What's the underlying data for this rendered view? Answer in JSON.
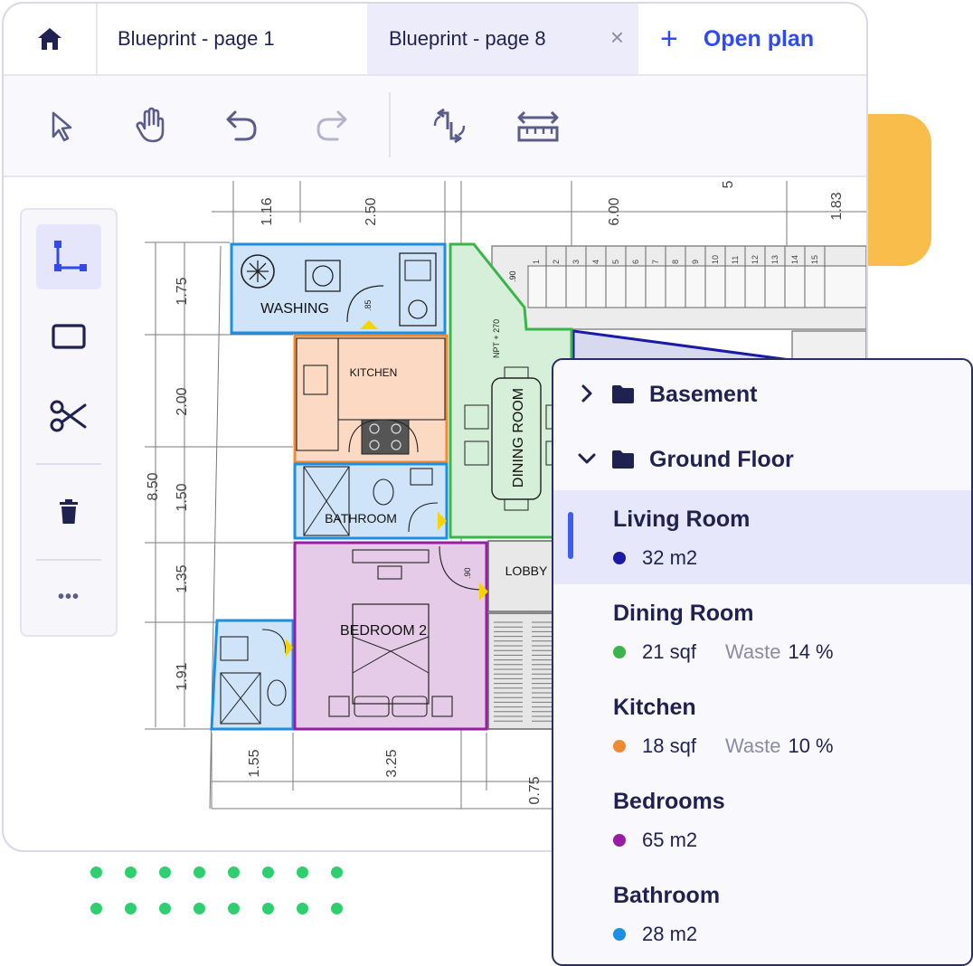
{
  "tabs": {
    "home_icon": "home-icon",
    "tab1": "Blueprint - page 1",
    "tab2": "Blueprint - page 8",
    "close_glyph": "×",
    "open_plan": "Open plan",
    "plus": "+"
  },
  "toolbar": {
    "tools": [
      "select-icon",
      "hand-icon",
      "undo-icon",
      "redo-icon",
      "rotate-icon",
      "measure-icon"
    ]
  },
  "sidebar": {
    "tools": [
      "line-tool-icon",
      "rectangle-icon",
      "scissors-icon",
      "trash-icon",
      "more-icon"
    ],
    "more_glyph": "•••"
  },
  "plan": {
    "rooms": {
      "washing": "WASHING",
      "kitchen": "KITCHEN",
      "bathroom": "BATHROOM",
      "bedroom": "BEDROOM 2",
      "dining": "DINING ROOM",
      "lobby": "LOBBY"
    },
    "dims_top": [
      "1.16",
      "2.50",
      "6.00",
      "5",
      "1.83"
    ],
    "dims_left": [
      "1.75",
      "2.00",
      "1.50",
      "1.35",
      "1.91"
    ],
    "dim_total": "8.50",
    "dims_bottom": [
      "1.55",
      "3.25",
      "0.75"
    ],
    "door_labels": [
      ".90",
      ".85",
      ".90"
    ],
    "npt": "NPT + 270",
    "stair_numbers": [
      "15",
      "14",
      "13",
      "12",
      "11",
      "10",
      "9",
      "8",
      "7",
      "6",
      "5",
      "4",
      "3",
      "2",
      "1"
    ],
    "colors": {
      "washing": "#1a8fe3",
      "kitchen": "#f08a32",
      "bathroom": "#1a8fe3",
      "bedroom": "#9a1ca6",
      "dining": "#3ab54a",
      "living": "#1a1aa6"
    }
  },
  "panel": {
    "groups": [
      {
        "label": "Basement",
        "expanded": false
      },
      {
        "label": "Ground Floor",
        "expanded": true
      }
    ],
    "items": [
      {
        "name": "Living Room",
        "area": "32 m2",
        "color": "#1a1aa6",
        "waste_label": "",
        "waste": "",
        "selected": true
      },
      {
        "name": "Dining Room",
        "area": "21 sqf",
        "color": "#3ab54a",
        "waste_label": "Waste",
        "waste": "14 %",
        "selected": false
      },
      {
        "name": "Kitchen",
        "area": "18 sqf",
        "color": "#f08a32",
        "waste_label": "Waste",
        "waste": "10 %",
        "selected": false
      },
      {
        "name": "Bedrooms",
        "area": "65 m2",
        "color": "#9a1ca6",
        "waste_label": "",
        "waste": "",
        "selected": false
      },
      {
        "name": "Bathroom",
        "area": "28 m2",
        "color": "#1a8fe3",
        "waste_label": "",
        "waste": "",
        "selected": false
      }
    ]
  },
  "colors": {
    "accent": "#2f4bf0",
    "deco_yellow": "#f8bd4b",
    "deco_dots": "#2fcf6f"
  }
}
